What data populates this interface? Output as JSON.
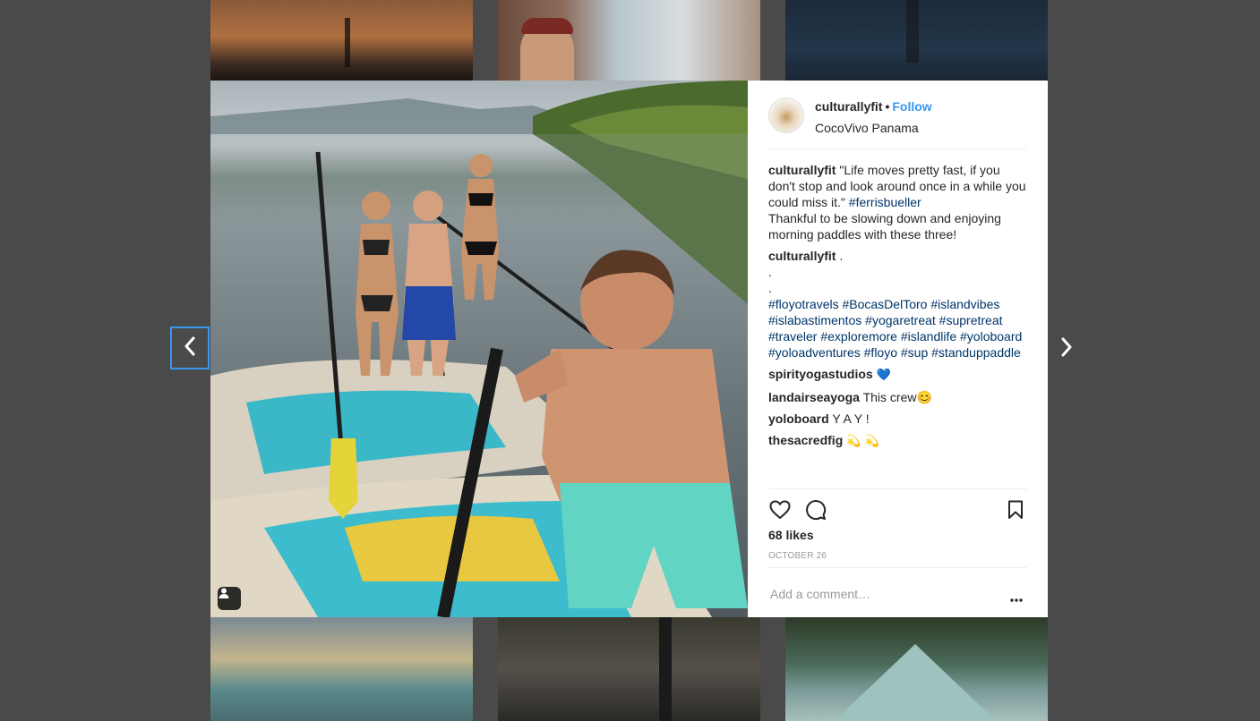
{
  "post": {
    "username": "culturallyfit",
    "separator": "•",
    "follow_label": "Follow",
    "location": "CocoVivo Panama",
    "caption": {
      "username": "culturallyfit",
      "text": "\"Life moves pretty fast, if you don't stop and look around once in a while you could miss it.\"",
      "hashtag": "#ferrisbueller",
      "text2": "Thankful to be slowing down and enjoying morning paddles with these three!"
    },
    "second_comment": {
      "username": "culturallyfit",
      "text": ".",
      "dots": [
        ".",
        "."
      ],
      "hashtags": [
        "#floyotravels",
        "#BocasDelToro",
        "#islandvibes",
        "#islabastimentos",
        "#yogaretreat",
        "#supretreat",
        "#traveler",
        "#exploremore",
        "#islandlife",
        "#yoloboard",
        "#yoloadventures",
        "#floyo",
        "#sup",
        "#standuppaddle"
      ]
    },
    "comments": [
      {
        "username": "spirityogastudios",
        "text": "💙"
      },
      {
        "username": "landairseayoga",
        "text": "This crew😊"
      },
      {
        "username": "yoloboard",
        "text": "Y A Y !"
      },
      {
        "username": "thesacredfig",
        "text": "💫 💫"
      }
    ],
    "likes": "68 likes",
    "date": "OCTOBER 26",
    "add_comment_placeholder": "Add a comment…",
    "more_options": "•••"
  },
  "icons": {
    "like": "heart-icon",
    "comment": "comment-icon",
    "save": "bookmark-icon",
    "tag_people": "user-tag-icon",
    "prev": "chevron-left-icon",
    "next": "chevron-right-icon"
  },
  "colors": {
    "link_blue": "#3897f0",
    "hashtag": "#003569",
    "text": "#262626",
    "muted": "#999999"
  }
}
